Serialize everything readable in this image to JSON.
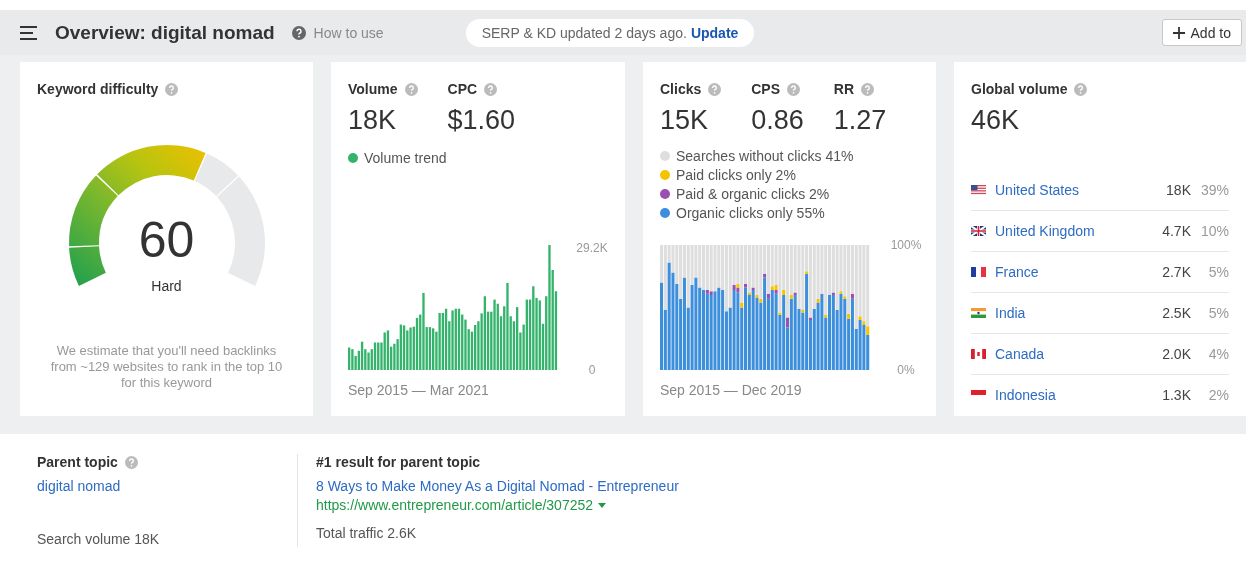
{
  "header": {
    "title": "Overview: digital nomad",
    "help_link": "How to use",
    "notice": {
      "text": "SERP & KD updated 2 days ago.",
      "link": "Update"
    },
    "add_button": "Add to"
  },
  "difficulty": {
    "label": "Keyword difficulty",
    "score": "60",
    "rating": "Hard",
    "note": "We estimate that you'll need backlinks from ~129 websites to rank in the top 10 for this keyword"
  },
  "volume": {
    "metrics": [
      {
        "label": "Volume",
        "value": "18K"
      },
      {
        "label": "CPC",
        "value": "$1.60"
      }
    ],
    "chart_data": {
      "type": "bar",
      "xlabel": "Sep 2015 — Mar 2021",
      "categories": [
        null,
        null,
        null,
        null,
        null,
        null,
        null,
        null,
        null,
        null,
        null,
        null,
        null,
        null,
        null,
        null,
        null,
        null,
        null,
        null,
        null,
        null,
        null,
        null,
        null,
        null,
        null,
        null,
        null,
        null,
        null,
        null,
        null,
        null,
        null,
        null,
        null,
        null,
        null,
        null,
        null,
        null,
        null,
        null,
        null,
        null,
        null,
        null,
        null,
        null,
        null,
        null,
        null,
        null,
        null,
        null,
        null,
        null,
        null,
        null,
        null,
        null,
        null,
        null,
        null
      ],
      "ylim": [
        0,
        30000
      ],
      "yticks": [
        {
          "value": 0,
          "label": "0"
        },
        {
          "value": 29200,
          "label": "29.2K"
        }
      ],
      "series": [
        {
          "name": "Volume trend",
          "color": "#33b36b",
          "values": [
            5400,
            5000,
            3400,
            4600,
            6800,
            5000,
            4200,
            5000,
            6600,
            6600,
            6600,
            9000,
            9500,
            5600,
            6300,
            7400,
            10900,
            10700,
            9500,
            10200,
            10400,
            12500,
            13300,
            18500,
            10300,
            10300,
            10000,
            9200,
            13700,
            13700,
            14700,
            11700,
            14300,
            14700,
            14700,
            13300,
            12100,
            9800,
            9200,
            10800,
            11700,
            13600,
            17700,
            14000,
            14000,
            16900,
            15900,
            12900,
            15300,
            20900,
            12900,
            11700,
            15100,
            9000,
            10900,
            16900,
            16900,
            20100,
            17300,
            16700,
            11100,
            17700,
            30000,
            24000,
            18900
          ]
        }
      ]
    }
  },
  "clicks": {
    "metrics": [
      {
        "label": "Clicks",
        "value": "15K"
      },
      {
        "label": "CPS",
        "value": "0.86"
      },
      {
        "label": "RR",
        "value": "1.27"
      }
    ],
    "chart_data": {
      "type": "bar",
      "stacked": true,
      "xlabel": "Sep 2015 — Dec 2019",
      "categories": [
        null,
        null,
        null,
        null,
        null,
        null,
        null,
        null,
        null,
        null,
        null,
        null,
        null,
        null,
        null,
        null,
        null,
        null,
        null,
        null,
        null,
        null,
        null,
        null,
        null,
        null,
        null,
        null,
        null,
        null,
        null,
        null,
        null,
        null,
        null,
        null,
        null,
        null,
        null,
        null,
        null,
        null,
        null,
        null,
        null,
        null,
        null,
        null,
        null,
        null,
        null,
        null,
        null,
        null,
        null
      ],
      "ylim": [
        0,
        100
      ],
      "yticks": [
        {
          "value": 0,
          "label": "0%"
        },
        {
          "value": 100,
          "label": "100%"
        }
      ],
      "series": [
        {
          "name": "Organic clicks only 55%",
          "color": "#3d8fdc",
          "values": [
            70,
            48,
            86,
            78,
            69,
            57,
            74,
            50,
            68,
            74,
            66,
            64,
            61,
            60,
            63,
            66,
            64,
            47,
            50,
            64,
            62,
            50,
            66,
            60,
            64,
            58,
            54,
            74,
            57,
            64,
            61,
            44,
            60,
            34,
            57,
            60,
            49,
            46,
            77,
            40,
            49,
            54,
            61,
            42,
            60,
            60,
            48,
            61,
            57,
            41,
            57,
            33,
            40,
            36,
            28
          ]
        },
        {
          "name": "Paid & organic clicks 2%",
          "color": "#9b4fb0",
          "values": [
            0,
            0,
            0,
            0,
            0,
            0,
            0,
            0,
            0,
            0,
            0,
            0,
            3,
            3,
            0,
            0,
            0,
            0,
            0,
            4,
            4,
            0,
            3,
            0,
            2,
            0,
            0,
            3,
            4,
            0,
            3,
            0,
            0,
            8,
            0,
            2,
            0,
            0,
            0,
            2,
            0,
            0,
            0,
            0,
            0,
            2,
            0,
            0,
            0,
            0,
            4,
            0,
            0,
            0,
            0
          ]
        },
        {
          "name": "Paid clicks only 2%",
          "color": "#f5c400",
          "values": [
            0,
            0,
            0,
            0,
            0,
            0,
            0,
            0,
            0,
            0,
            0,
            0,
            0,
            0,
            0,
            0,
            0,
            0,
            0,
            0,
            3,
            4,
            0,
            2,
            0,
            2,
            3,
            0,
            0,
            3,
            4,
            2,
            4,
            0,
            3,
            0,
            0,
            2,
            2,
            0,
            0,
            3,
            0,
            2,
            0,
            0,
            0,
            2,
            2,
            4,
            0,
            0,
            3,
            3,
            7
          ]
        },
        {
          "name": "Searches without clicks 41%",
          "color": "#dedede",
          "values": [
            30,
            52,
            14,
            22,
            31,
            43,
            26,
            50,
            32,
            26,
            34,
            36,
            36,
            37,
            37,
            34,
            36,
            53,
            50,
            32,
            31,
            46,
            31,
            38,
            34,
            40,
            43,
            23,
            39,
            33,
            32,
            54,
            36,
            58,
            40,
            38,
            51,
            52,
            21,
            58,
            51,
            43,
            39,
            56,
            40,
            38,
            52,
            37,
            41,
            55,
            39,
            67,
            57,
            61,
            65
          ]
        }
      ]
    }
  },
  "global_volume": {
    "label": "Global volume",
    "value": "46K",
    "countries": [
      {
        "name": "United States",
        "volume": "18K",
        "share": "39%"
      },
      {
        "name": "United Kingdom",
        "volume": "4.7K",
        "share": "10%"
      },
      {
        "name": "France",
        "volume": "2.7K",
        "share": "5%"
      },
      {
        "name": "India",
        "volume": "2.5K",
        "share": "5%"
      },
      {
        "name": "Canada",
        "volume": "2.0K",
        "share": "4%"
      },
      {
        "name": "Indonesia",
        "volume": "1.3K",
        "share": "2%"
      }
    ]
  },
  "parent_topic": {
    "label": "Parent topic",
    "topic": "digital nomad",
    "search_volume": "Search volume 18K"
  },
  "top_result": {
    "label": "#1 result for parent topic",
    "title": "8 Ways to Make Money As a Digital Nomad - Entrepreneur",
    "url": "https://www.entrepreneur.com/article/307252",
    "traffic": "Total traffic 2.6K"
  }
}
